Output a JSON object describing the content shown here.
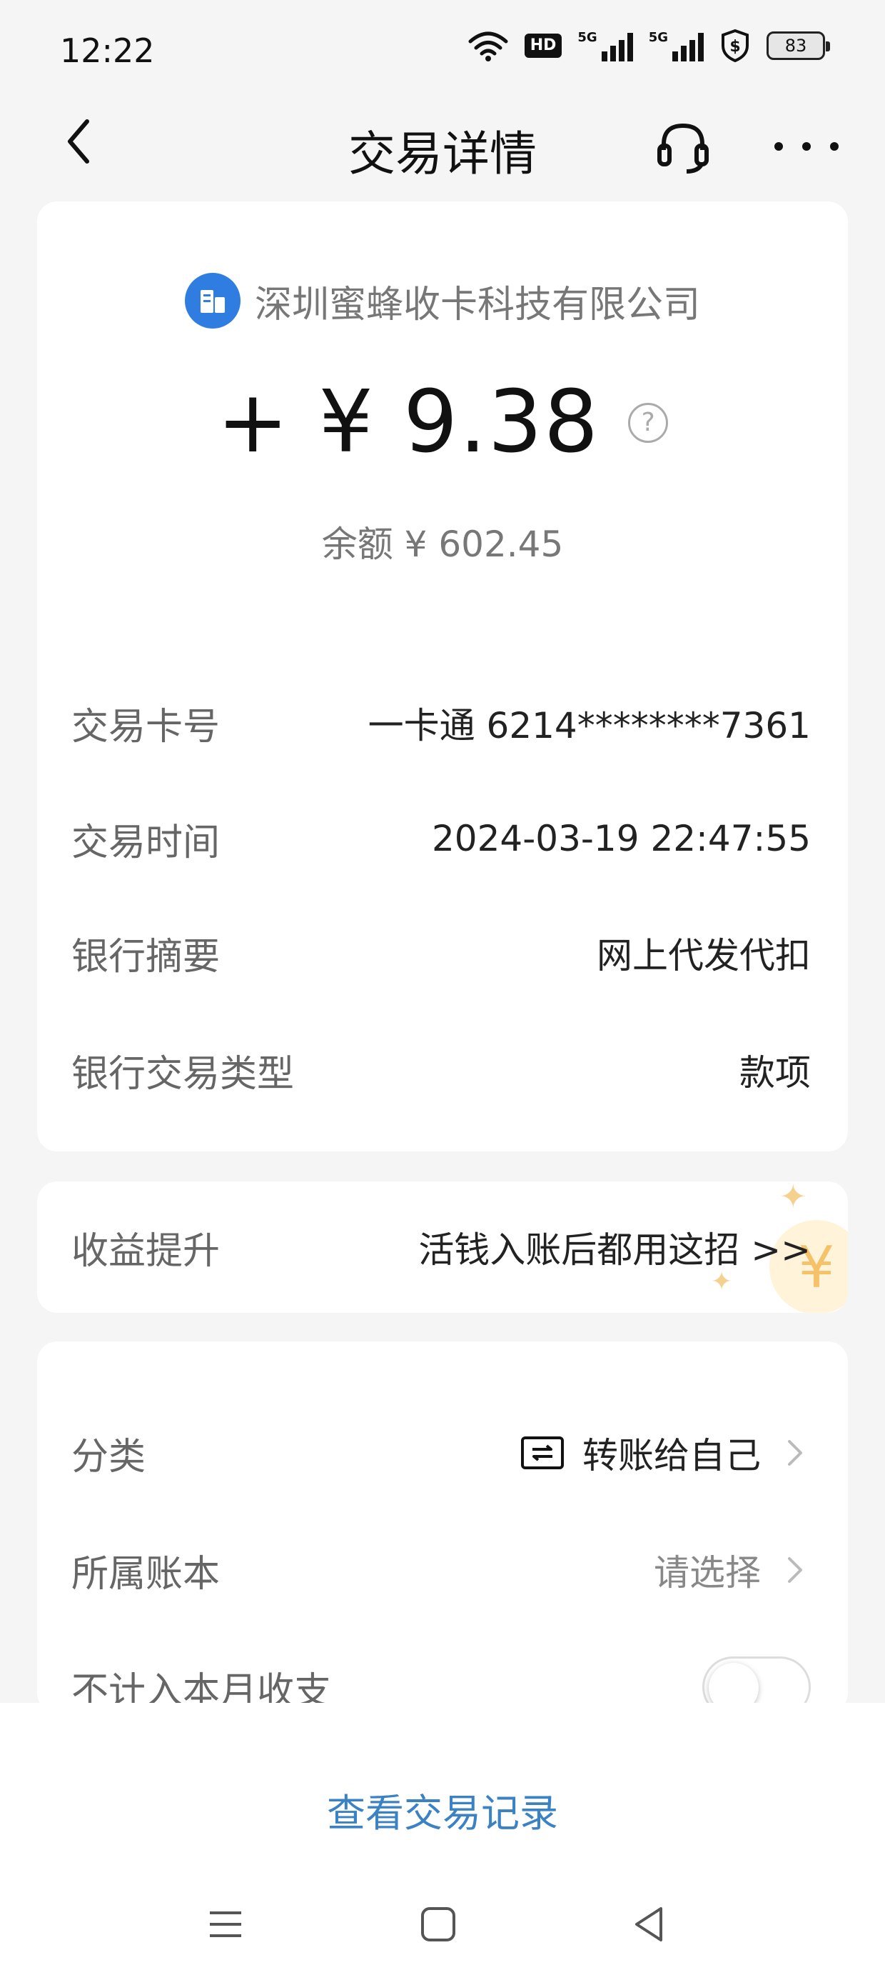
{
  "status_bar": {
    "time": "12:22",
    "net_tag_1": "5G",
    "net_tag_2": "5G",
    "hd_label": "HD",
    "battery": "83"
  },
  "nav": {
    "title": "交易详情"
  },
  "merchant": {
    "name": "深圳蜜蜂收卡科技有限公司"
  },
  "amount": {
    "text": "+ ¥ 9.38",
    "help": "?"
  },
  "balance": "余额 ¥ 602.45",
  "details": [
    {
      "label": "交易卡号",
      "value": "一卡通 6214********7361"
    },
    {
      "label": "交易时间",
      "value": "2024-03-19 22:47:55"
    },
    {
      "label": "银行摘要",
      "value": "网上代发代扣"
    },
    {
      "label": "银行交易类型",
      "value": "款项"
    }
  ],
  "boost": {
    "label": "收益提升",
    "value": "活钱入账后都用这招 >>",
    "deco": "¥",
    "spark_glyph": "✦"
  },
  "category": {
    "label": "分类",
    "value": "转账给自己"
  },
  "ledger": {
    "label": "所属账本",
    "placeholder": "请选择"
  },
  "exclude": {
    "label": "不计入本月收支",
    "enabled": false
  },
  "bottom_link": "查看交易记录",
  "colors": {
    "accent": "#3b82c4",
    "merchant_logo": "#2f7de1",
    "background": "#f5f5f5"
  }
}
